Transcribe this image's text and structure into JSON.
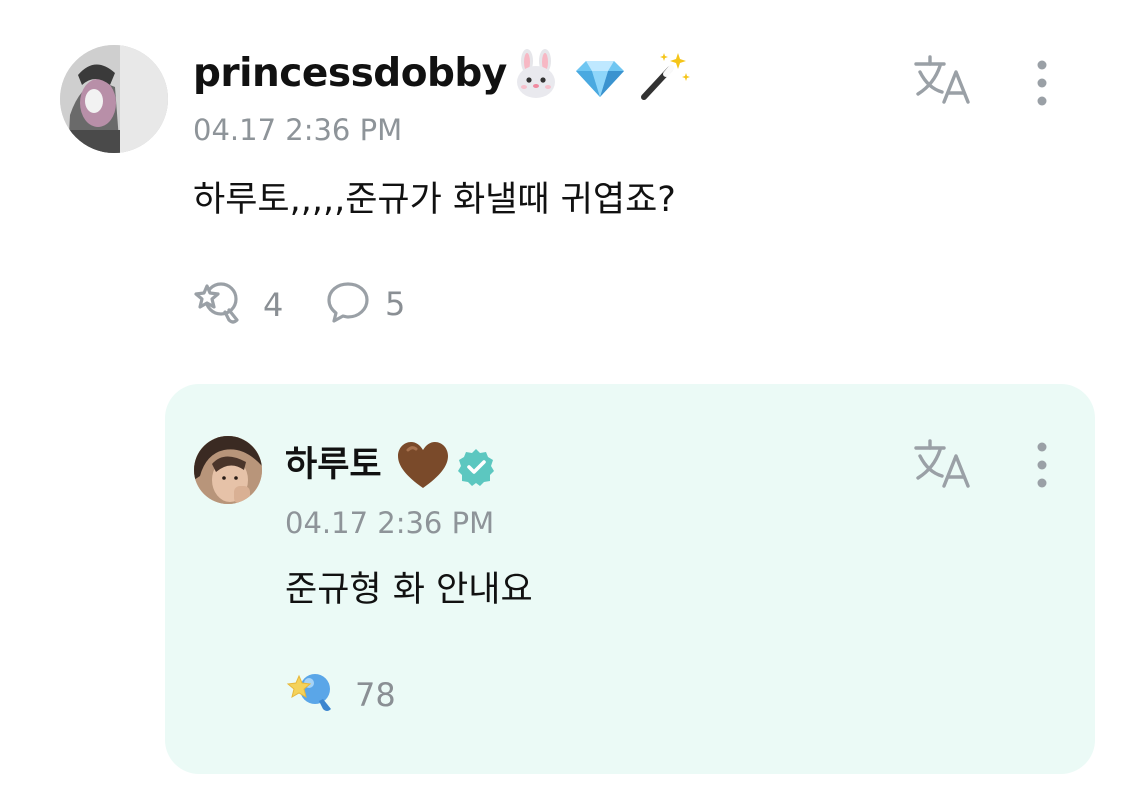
{
  "post": {
    "username": "princessdobby",
    "badges": [
      "rabbit-face-emoji",
      "gem-emoji",
      "magic-wand-emoji"
    ],
    "timestamp": "04.17 2:36 PM",
    "text": "하루토,,,,,준규가 화낼때 귀엽죠?",
    "likes": "4",
    "comments": "5"
  },
  "reply": {
    "username": "하루토",
    "badges": [
      "brown-heart-emoji",
      "verified-badge"
    ],
    "timestamp": "04.17 2:36 PM",
    "text": "준규형 화 안내요",
    "likes": "78"
  },
  "colors": {
    "reply_background": "#ebfaf6",
    "muted_text": "#8e9499",
    "verified": "#5cc7c0",
    "artist_like_blue": "#5aa6e8",
    "artist_like_star": "#f4d25a"
  },
  "icons": {
    "translate": "translate-icon",
    "more": "more-vertical-icon",
    "like": "star-bubble-like-icon",
    "comment": "speech-bubble-icon"
  }
}
